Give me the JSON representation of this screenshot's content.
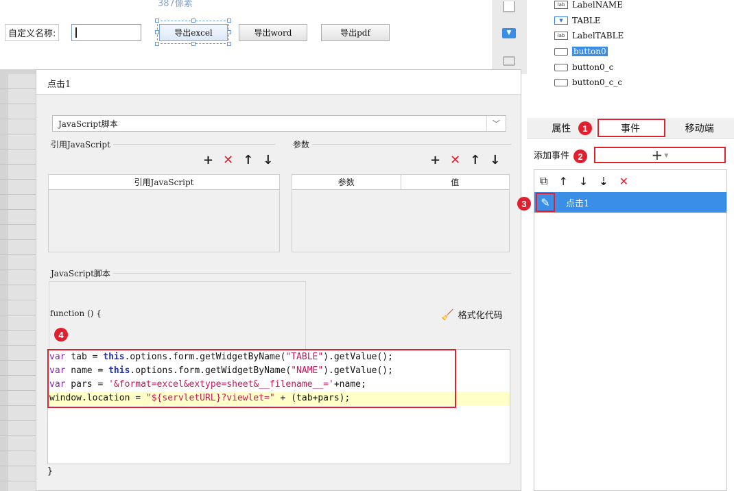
{
  "canvas": {
    "pixel_hint": "387像素",
    "name_label": "自定义名称:",
    "buttons": [
      "导出excel",
      "导出word",
      "导出pdf"
    ]
  },
  "widget_tree": {
    "items": [
      {
        "icon": "label-icon",
        "icon_text": "lab",
        "label": "LabelNAME"
      },
      {
        "icon": "combo-icon",
        "icon_text": "▼",
        "label": "TABLE"
      },
      {
        "icon": "label-icon",
        "icon_text": "lab",
        "label": "LabelTABLE"
      },
      {
        "icon": "button-icon",
        "icon_text": "",
        "label": "button0",
        "selected": true
      },
      {
        "icon": "button-icon",
        "icon_text": "",
        "label": "button0_c"
      },
      {
        "icon": "button-icon",
        "icon_text": "",
        "label": "button0_c_c"
      }
    ]
  },
  "right_panel": {
    "tabs": [
      "属性",
      "事件",
      "移动端"
    ],
    "active_tab": "事件",
    "add_event_label": "添加事件",
    "add_event_plus": "+",
    "event_toolbar": [
      "copy-icon",
      "arrow-up-icon",
      "arrow-down-icon",
      "sort-down-icon",
      "delete-icon"
    ],
    "events": [
      "点击1"
    ]
  },
  "markers": [
    "1",
    "2",
    "3",
    "4"
  ],
  "dialog": {
    "title": "点击1",
    "type_select": "JavaScript脚本",
    "ref_js_group": "引用JavaScript",
    "params_group": "参数",
    "ref_js_column": "引用JavaScript",
    "param_columns": [
      "参数",
      "值"
    ],
    "script_group": "JavaScript脚本",
    "function_open": "function () {",
    "format_code": "格式化代码",
    "function_close": "}",
    "code_lines": [
      "var tab = this.options.form.getWidgetByName(\"TABLE\").getValue();",
      "var name = this.options.form.getWidgetByName(\"NAME\").getValue();",
      "var pars = '&format=excel&extype=sheet&__filename__='+name;",
      "window.location = \"${servletURL}?viewlet=\" + (tab+pars);"
    ]
  },
  "colors": {
    "accent": "#3a8ee6",
    "highlight_red": "#e0202e",
    "keyword": "#1f2fc8",
    "string": "#c2185b"
  }
}
